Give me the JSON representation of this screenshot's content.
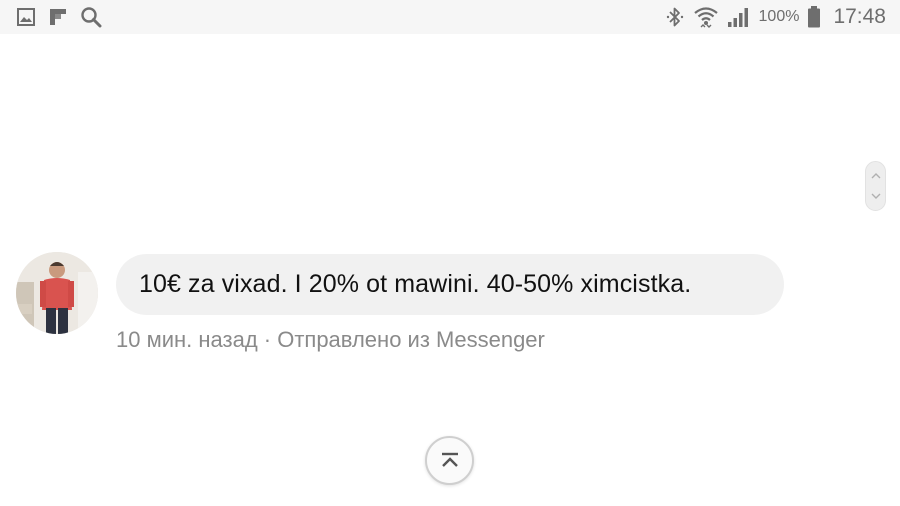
{
  "status_bar": {
    "battery_percent": "100%",
    "time": "17:48",
    "left_icons": [
      "gallery-icon",
      "flipboard-icon",
      "search-icon"
    ],
    "right_icons": [
      "bluetooth-icon",
      "wifi-icon",
      "signal-icon",
      "battery-icon"
    ]
  },
  "message": {
    "text": "10€ za vixad. I 20% ot mawini. 40-50% ximcistka.",
    "meta": "10 мин. назад · Отправлено из Messenger"
  },
  "controls": {
    "scroll_icon": "scroll-up-down-icon",
    "top_button_icon": "scroll-to-top-icon"
  },
  "colors": {
    "bubble_bg": "#f1f1f1",
    "status_bar_bg": "#f6f6f6",
    "meta_text": "#8a8a8a",
    "icon_gray": "#6e6e6e"
  }
}
